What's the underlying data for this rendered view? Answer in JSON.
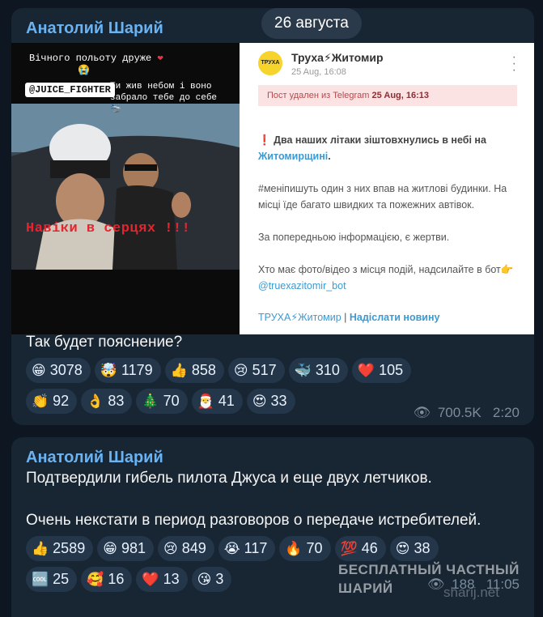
{
  "date_pill": "26 августа",
  "post1": {
    "author": "Анатолий Шарий",
    "photo": {
      "line1": "Вічного польоту друже",
      "line1_emoji": "❤",
      "line1_emoji2": "😭",
      "tag": "@JUICE_FIGHTER",
      "line2": "Ти жив небом і воно забрало тебе до себе 🛬",
      "overlay": "Навіки в серцях !!!"
    },
    "telegram_card": {
      "avatar": "ТРУХА",
      "channel": "Труха⚡Житомир",
      "time": "25 Aug, 16:08",
      "deleted_prefix": "Пост удален из Telegram",
      "deleted_date": "25 Aug, 16:13",
      "alert_mark": "❗",
      "headline": "Два наших літаки зіштовхнулись в небі на",
      "headline_link": "Житомирщині",
      "headline_end": ".",
      "p2": "#меніпишуть один з них впав на житлові будинки. На місці їде багато швидких та пожежних автівок.",
      "p3": "За попередньою інформацією, є жертви.",
      "p4": "Хто має фото/відео з місця подій, надсилайте в бот👉",
      "p4_link": "@truexazitomir_bot",
      "footer_link": "ТРУХА⚡Житомир",
      "footer_sep": " | ",
      "footer_bold": "Надіслати новину"
    },
    "caption": "Так будет пояснение?",
    "reactions_row1": [
      {
        "emoji": "😁",
        "count": "3078"
      },
      {
        "emoji": "🤯",
        "count": "1179"
      },
      {
        "emoji": "👍",
        "count": "858"
      },
      {
        "emoji": "😢",
        "count": "517"
      },
      {
        "emoji": "🐳",
        "count": "310"
      },
      {
        "emoji": "❤️",
        "count": "105"
      }
    ],
    "reactions_row2": [
      {
        "emoji": "👏",
        "count": "92"
      },
      {
        "emoji": "👌",
        "count": "83"
      },
      {
        "emoji": "🎄",
        "count": "70"
      },
      {
        "emoji": "🎅",
        "count": "41"
      },
      {
        "emoji": "😍",
        "count": "33"
      }
    ],
    "views": "700.5K",
    "time": "2:20"
  },
  "post2": {
    "author": "Анатолий Шарий",
    "line1": "Подтвердили гибель пилота Джуса и еще двух летчиков.",
    "line2": "Очень некстати в период разговоров о передаче истребителей.",
    "reactions_row1": [
      {
        "emoji": "👍",
        "count": "2589"
      },
      {
        "emoji": "😁",
        "count": "981"
      },
      {
        "emoji": "😢",
        "count": "849"
      },
      {
        "emoji": "😭",
        "count": "117"
      },
      {
        "emoji": "🔥",
        "count": "70"
      },
      {
        "emoji": "💯",
        "count": "46"
      },
      {
        "emoji": "😍",
        "count": "38"
      }
    ],
    "reactions_row2": [
      {
        "emoji": "🆒",
        "count": "25"
      },
      {
        "emoji": "🥰",
        "count": "16"
      },
      {
        "emoji": "❤️",
        "count": "13"
      },
      {
        "emoji": "😘",
        "count": "3"
      }
    ],
    "views_partial": "188",
    "time_partial": "11:05"
  },
  "watermark": {
    "line1": "БЕСПЛАТНЫЙ ЧАСТНЫЙ",
    "line2": "ШАРИЙ",
    "site": "sharij.net"
  }
}
